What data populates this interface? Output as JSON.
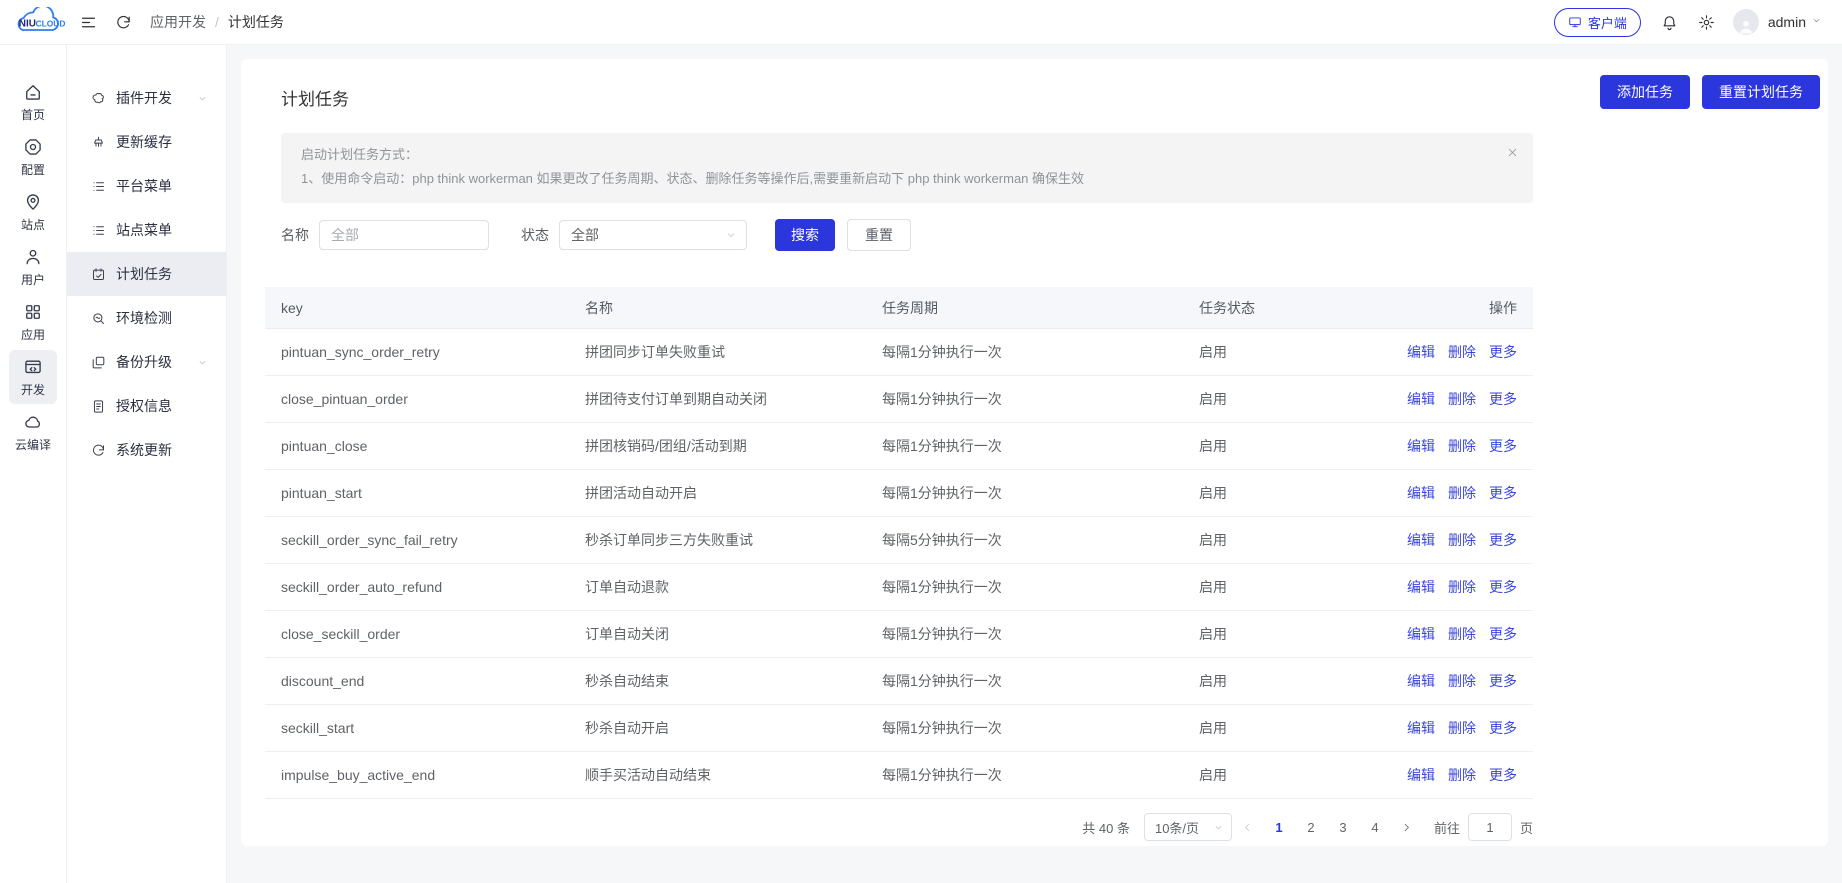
{
  "navbar": {
    "logo_niu": "NIU",
    "logo_cloud": "CLOUD",
    "breadcrumb": {
      "parent": "应用开发",
      "separator": "/",
      "current": "计划任务"
    },
    "client_button": "客户端",
    "username": "admin"
  },
  "icon_sidebar": {
    "items": [
      {
        "label": "首页",
        "icon": "home-icon",
        "active": false
      },
      {
        "label": "配置",
        "icon": "config-icon",
        "active": false
      },
      {
        "label": "站点",
        "icon": "site-icon",
        "active": false
      },
      {
        "label": "用户",
        "icon": "user-icon",
        "active": false
      },
      {
        "label": "应用",
        "icon": "apps-icon",
        "active": false
      },
      {
        "label": "开发",
        "icon": "dev-icon",
        "active": true
      },
      {
        "label": "云编译",
        "icon": "cloud-icon",
        "active": false
      }
    ]
  },
  "submenu": {
    "items": [
      {
        "label": "插件开发",
        "icon": "plugin-icon",
        "expandable": true,
        "active": false
      },
      {
        "label": "更新缓存",
        "icon": "brush-icon",
        "expandable": false,
        "active": false
      },
      {
        "label": "平台菜单",
        "icon": "list-icon",
        "expandable": false,
        "active": false
      },
      {
        "label": "站点菜单",
        "icon": "list-icon",
        "expandable": false,
        "active": false
      },
      {
        "label": "计划任务",
        "icon": "calendar-icon",
        "expandable": false,
        "active": true
      },
      {
        "label": "环境检测",
        "icon": "env-icon",
        "expandable": false,
        "active": false
      },
      {
        "label": "备份升级",
        "icon": "backup-icon",
        "expandable": true,
        "active": false
      },
      {
        "label": "授权信息",
        "icon": "license-icon",
        "expandable": false,
        "active": false
      },
      {
        "label": "系统更新",
        "icon": "refresh-icon",
        "expandable": false,
        "active": false
      }
    ]
  },
  "page": {
    "title": "计划任务",
    "add_task_button": "添加任务",
    "reset_tasks_button": "重置计划任务",
    "notice": {
      "line1": "启动计划任务方式：",
      "line2": "1、使用命令启动：php think workerman 如果更改了任务周期、状态、删除任务等操作后,需要重新启动下 php think workerman 确保生效"
    },
    "filters": {
      "name_label": "名称",
      "name_placeholder": "全部",
      "status_label": "状态",
      "status_value": "全部",
      "search_button": "搜索",
      "reset_button": "重置"
    }
  },
  "table": {
    "columns": [
      "key",
      "名称",
      "任务周期",
      "任务状态",
      "操作"
    ],
    "action_labels": [
      "编辑",
      "删除",
      "更多"
    ],
    "rows": [
      {
        "key": "pintuan_sync_order_retry",
        "name": "拼团同步订单失败重试",
        "cycle": "每隔1分钟执行一次",
        "status": "启用"
      },
      {
        "key": "close_pintuan_order",
        "name": "拼团待支付订单到期自动关闭",
        "cycle": "每隔1分钟执行一次",
        "status": "启用"
      },
      {
        "key": "pintuan_close",
        "name": "拼团核销码/团组/活动到期",
        "cycle": "每隔1分钟执行一次",
        "status": "启用"
      },
      {
        "key": "pintuan_start",
        "name": "拼团活动自动开启",
        "cycle": "每隔1分钟执行一次",
        "status": "启用"
      },
      {
        "key": "seckill_order_sync_fail_retry",
        "name": "秒杀订单同步三方失败重试",
        "cycle": "每隔5分钟执行一次",
        "status": "启用"
      },
      {
        "key": "seckill_order_auto_refund",
        "name": "订单自动退款",
        "cycle": "每隔1分钟执行一次",
        "status": "启用"
      },
      {
        "key": "close_seckill_order",
        "name": "订单自动关闭",
        "cycle": "每隔1分钟执行一次",
        "status": "启用"
      },
      {
        "key": "discount_end",
        "name": "秒杀自动结束",
        "cycle": "每隔1分钟执行一次",
        "status": "启用"
      },
      {
        "key": "seckill_start",
        "name": "秒杀自动开启",
        "cycle": "每隔1分钟执行一次",
        "status": "启用"
      },
      {
        "key": "impulse_buy_active_end",
        "name": "顺手买活动自动结束",
        "cycle": "每隔1分钟执行一次",
        "status": "启用"
      }
    ]
  },
  "pagination": {
    "total": "共 40 条",
    "page_size": "10条/页",
    "pages": [
      "1",
      "2",
      "3",
      "4"
    ],
    "active_page": "1",
    "goto_label": "前往",
    "goto_value": "1",
    "unit_label": "页"
  },
  "colors": {
    "primary": "#2b36dd",
    "link": "#3a47dd",
    "header_bg": "#f5f7fa"
  }
}
